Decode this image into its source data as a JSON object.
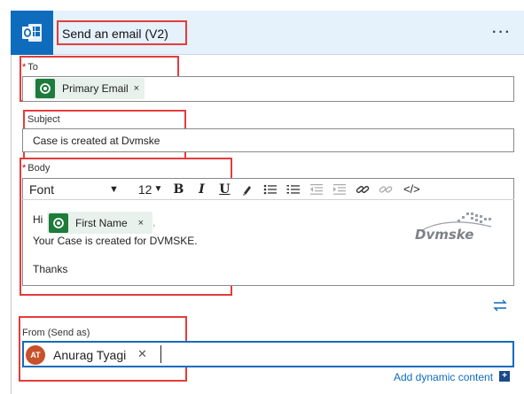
{
  "header": {
    "title": "Send an email (V2)",
    "more_label": "···",
    "app_icon": "outlook-icon"
  },
  "to": {
    "label": "To",
    "required": "*",
    "token_label": "Primary Email",
    "token_close": "×",
    "token_icon": "dataverse-icon"
  },
  "subject": {
    "label": "Subject",
    "value": "Case is created at Dvmske"
  },
  "body": {
    "label": "Body",
    "required": "*",
    "toolbar": {
      "font": "Font",
      "font_caret": "▼",
      "size": "12",
      "size_caret": "▼",
      "bold": "B",
      "italic": "I",
      "underline": "U",
      "code": "</>"
    },
    "greeting": "Hi",
    "token_label": "First Name",
    "token_close": "×",
    "token_suffix": ",",
    "line2": "Your Case is created for DVMSKE.",
    "line3": "Thanks",
    "watermark": "Dvmske"
  },
  "from": {
    "label": "From (Send as)",
    "avatar_initials": "AT",
    "person": "Anurag Tyagi",
    "remove": "✕"
  },
  "footer": {
    "add_dynamic": "Add dynamic content",
    "add_plus": "+"
  },
  "colors": {
    "accent": "#0f6cbd",
    "highlight": "#e53c3c",
    "token_bg": "#e8f1ec",
    "token_icon": "#1e7b3c",
    "avatar": "#c8502a"
  }
}
